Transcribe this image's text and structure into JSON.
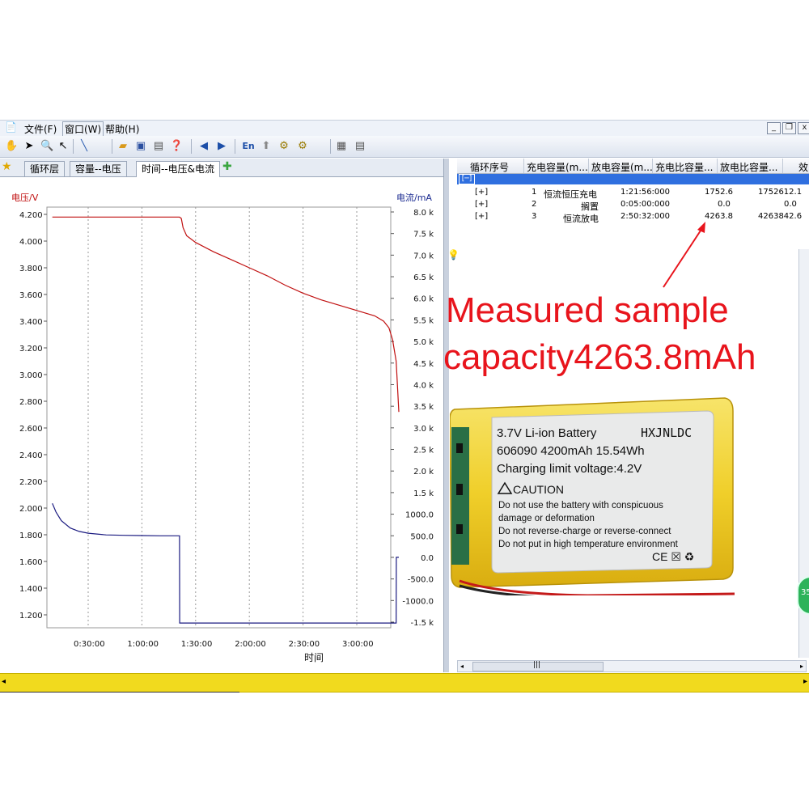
{
  "menu": {
    "file": "文件(F)",
    "window": "窗口(W)",
    "help": "帮助(H)"
  },
  "window_controls": {
    "minimize": "_",
    "restore": "❐",
    "close": "x"
  },
  "tabs": [
    {
      "label": "循环层"
    },
    {
      "label": "容量--电压"
    },
    {
      "label": "时间--电压&电流",
      "active": true
    }
  ],
  "toolbar": {
    "lang_label": "En"
  },
  "chart_data": {
    "type": "line",
    "left_axis_label": "电压/V",
    "right_axis_label": "电流/mA",
    "xlabel": "时间",
    "left_ticks": [
      "4.200",
      "4.000",
      "3.800",
      "3.600",
      "3.400",
      "3.200",
      "3.000",
      "2.800",
      "2.600",
      "2.400",
      "2.200",
      "2.000",
      "1.800",
      "1.600",
      "1.400",
      "1.200"
    ],
    "right_ticks": [
      "8.0 k",
      "7.5 k",
      "7.0 k",
      "6.5 k",
      "6.0 k",
      "5.5 k",
      "5.0 k",
      "4.5 k",
      "4.0 k",
      "3.5 k",
      "3.0 k",
      "2.5 k",
      "2.0 k",
      "1.5 k",
      "1000.0",
      "500.0",
      "0.0",
      "-500.0",
      "-1000.0",
      "-1.5 k"
    ],
    "x_ticks": [
      "0:30:00",
      "1:00:00",
      "1:30:00",
      "2:00:00",
      "2:30:00",
      "3:00:00"
    ],
    "ylim_left": [
      1.1,
      4.25
    ],
    "ylim_right": [
      -1650,
      8050
    ],
    "xlim_minutes": [
      0,
      210
    ],
    "series": [
      {
        "axis": "left",
        "color": "#c01010",
        "x_minutes": [
          10,
          81,
          82,
          83,
          85,
          90,
          100,
          110,
          120,
          130,
          140,
          150,
          160,
          170,
          180,
          190,
          195,
          198,
          200,
          202,
          203.5
        ],
        "y": [
          4.18,
          4.18,
          4.17,
          4.1,
          4.04,
          3.99,
          3.92,
          3.86,
          3.8,
          3.74,
          3.67,
          3.61,
          3.56,
          3.52,
          3.48,
          3.44,
          3.4,
          3.35,
          3.26,
          3.1,
          2.72
        ]
      },
      {
        "axis": "right",
        "color": "#1a1a80",
        "x_minutes": [
          10,
          12,
          15,
          20,
          25,
          30,
          40,
          50,
          60,
          70,
          81,
          81.1,
          202,
          202.1,
          203.5
        ],
        "y": [
          1250,
          1050,
          850,
          680,
          600,
          560,
          520,
          510,
          505,
          500,
          500,
          -1520,
          -1520,
          0,
          0
        ]
      }
    ]
  },
  "table": {
    "headers": [
      "循环序号",
      "充电容量(m...",
      "放电容量(m...",
      "充电比容量...",
      "放电比容量...",
      "效"
    ],
    "collapse_label": "[─]",
    "rows": [
      {
        "expand": "[+]",
        "index": "1",
        "step": "恒流恒压充电",
        "time": "1:21:56:000",
        "capacity": "1752.6",
        "specific": "1752612.1"
      },
      {
        "expand": "[+]",
        "index": "2",
        "step": "搁置",
        "time": "0:05:00:000",
        "capacity": "0.0",
        "specific": "0.0"
      },
      {
        "expand": "[+]",
        "index": "3",
        "step": "恒流放电",
        "time": "2:50:32:000",
        "capacity": "4263.8",
        "specific": "4263842.6"
      }
    ]
  },
  "annotation": {
    "line1": "Measured sample",
    "line2": "capacity4263.8mAh",
    "color": "#e8141c"
  },
  "battery_label": {
    "line1": "3.7V Li-ion Battery",
    "brand": "HXJNLDC",
    "line2": "606090 4200mAh 15.54Wh",
    "line3": "Charging limit voltage:4.2V",
    "caution_title": "CAUTION",
    "caution1": "Do not use the battery with conspicuous",
    "caution2": "damage or deformation",
    "caution3": "Do not reverse-charge or reverse-connect",
    "caution4": "Do not put in high temperature environment",
    "marks": "CE ☒ ♻"
  },
  "green_badge": "35",
  "scroll_grip": "|||"
}
